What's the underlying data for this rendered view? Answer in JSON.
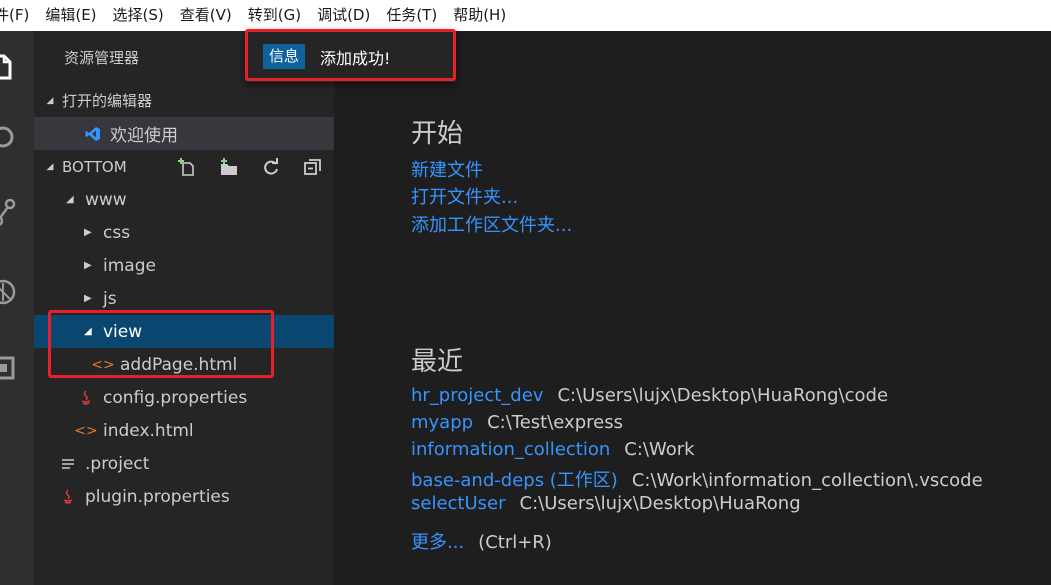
{
  "menubar": {
    "items": [
      "件(F)",
      "编辑(E)",
      "选择(S)",
      "查看(V)",
      "转到(G)",
      "调试(D)",
      "任务(T)",
      "帮助(H)"
    ]
  },
  "notification": {
    "badge": "信息",
    "message": "添加成功!"
  },
  "sidebar": {
    "title": "资源管理器",
    "open_editors": {
      "label": "打开的编辑器",
      "items": [
        {
          "label": "欢迎使用",
          "icon": "vscode-icon"
        }
      ]
    },
    "folder": {
      "label": "BOTTOM",
      "tree": [
        {
          "label": "www",
          "kind": "folder",
          "expanded": true,
          "depth": 0
        },
        {
          "label": "css",
          "kind": "folder",
          "expanded": false,
          "depth": 1
        },
        {
          "label": "image",
          "kind": "folder",
          "expanded": false,
          "depth": 1
        },
        {
          "label": "js",
          "kind": "folder",
          "expanded": false,
          "depth": 1
        },
        {
          "label": "view",
          "kind": "folder",
          "expanded": true,
          "depth": 1,
          "selected": true
        },
        {
          "label": "addPage.html",
          "kind": "file",
          "icon": "html-icon",
          "depth": 2
        },
        {
          "label": "config.properties",
          "kind": "file",
          "icon": "java-icon",
          "depth": 1
        },
        {
          "label": "index.html",
          "kind": "file",
          "icon": "html-icon",
          "depth": 1
        },
        {
          "label": ".project",
          "kind": "file",
          "icon": "lines-icon",
          "depth": 0
        },
        {
          "label": "plugin.properties",
          "kind": "file",
          "icon": "java-icon",
          "depth": 0
        }
      ]
    }
  },
  "welcome": {
    "start_title": "开始",
    "start_links": [
      "新建文件",
      "打开文件夹...",
      "添加工作区文件夹..."
    ],
    "recent_title": "最近",
    "recent": [
      {
        "name": "hr_project_dev",
        "path": "C:\\Users\\lujx\\Desktop\\HuaRong\\code"
      },
      {
        "name": "myapp",
        "path": "C:\\Test\\express"
      },
      {
        "name": "information_collection",
        "path": "C:\\Work"
      },
      {
        "name": "base-and-deps (工作区)",
        "path": "C:\\Work\\information_collection\\.vscode"
      },
      {
        "name": "selectUser",
        "path": "C:\\Users\\lujx\\Desktop\\HuaRong"
      }
    ],
    "more_link": "更多...",
    "more_hint": "(Ctrl+R)"
  },
  "colors": {
    "link": "#3794ff",
    "selection": "#094771",
    "highlight_box": "#e8202a",
    "badge": "#0e639c"
  }
}
